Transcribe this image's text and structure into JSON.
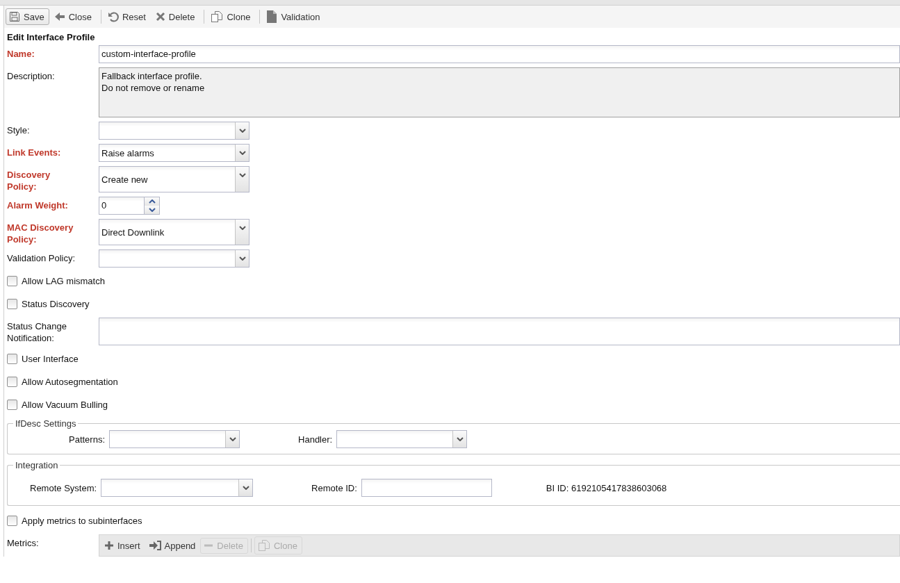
{
  "toolbar": [
    {
      "kind": "save",
      "label": "Save",
      "focused": true
    },
    {
      "kind": "close",
      "label": "Close",
      "focused": false
    },
    {
      "kind": "separator"
    },
    {
      "kind": "reset",
      "label": "Reset",
      "focused": false
    },
    {
      "kind": "delete",
      "label": "Delete",
      "focused": false
    },
    {
      "kind": "separator"
    },
    {
      "kind": "clone",
      "label": "Clone",
      "focused": false
    },
    {
      "kind": "separator"
    },
    {
      "kind": "validation",
      "label": "Validation",
      "focused": false
    }
  ],
  "title": "Edit Interface Profile",
  "fields": [
    {
      "kind": "text",
      "label": "Name:",
      "required": true,
      "value": "custom-interface-profile"
    },
    {
      "kind": "textarea",
      "label": "Description:",
      "required": false,
      "value": "Fallback interface profile.\nDo not remove or rename"
    },
    {
      "kind": "combo",
      "label": "Style:",
      "required": false
    },
    {
      "kind": "combo",
      "label": "Link Events:",
      "required": true,
      "value": "Raise alarms"
    },
    {
      "kind": "combo",
      "label": "Discovery Policy:",
      "required": true,
      "value": "Create new"
    },
    {
      "kind": "number",
      "label": "Alarm Weight:",
      "required": true,
      "value": "0"
    },
    {
      "kind": "combo",
      "label": "MAC Discovery Policy:",
      "required": true,
      "value": "Direct Downlink"
    },
    {
      "kind": "combo",
      "label": "Validation Policy:",
      "required": false
    },
    {
      "kind": "checkbox",
      "label": "Allow LAG mismatch",
      "checked": false
    },
    {
      "kind": "checkbox",
      "label": "Status Discovery",
      "checked": false
    },
    {
      "kind": "memo",
      "label": "Status Change Notification:",
      "required": false
    },
    {
      "kind": "checkbox",
      "label": "User Interface",
      "checked": false
    },
    {
      "kind": "checkbox",
      "label": "Allow Autosegmentation",
      "checked": false
    },
    {
      "kind": "checkbox",
      "label": "Allow Vacuum Bulling",
      "checked": false
    }
  ],
  "groups": [
    {
      "legend": "IfDesc Settings",
      "items": [
        {
          "kind": "combo",
          "label": "Patterns:"
        },
        {
          "kind": "combo",
          "label": "Handler:"
        }
      ]
    },
    {
      "legend": "Integration",
      "items": [
        {
          "kind": "combo",
          "label": "Remote System:"
        },
        {
          "kind": "text",
          "label": "Remote ID:"
        },
        {
          "kind": "info",
          "label": "BI ID: 6192105417838603068"
        }
      ]
    }
  ],
  "after_groups": [
    {
      "kind": "checkbox",
      "label": "Apply metrics to subinterfaces",
      "checked": false
    }
  ],
  "metrics": {
    "label": "Metrics:",
    "toolbar": [
      {
        "kind": "insert",
        "label": "Insert",
        "disabled": false
      },
      {
        "kind": "append",
        "label": "Append",
        "disabled": false
      },
      {
        "kind": "delete",
        "label": "Delete",
        "disabled": true
      },
      {
        "kind": "separator"
      },
      {
        "kind": "clone",
        "label": "Clone",
        "disabled": true
      }
    ]
  }
}
